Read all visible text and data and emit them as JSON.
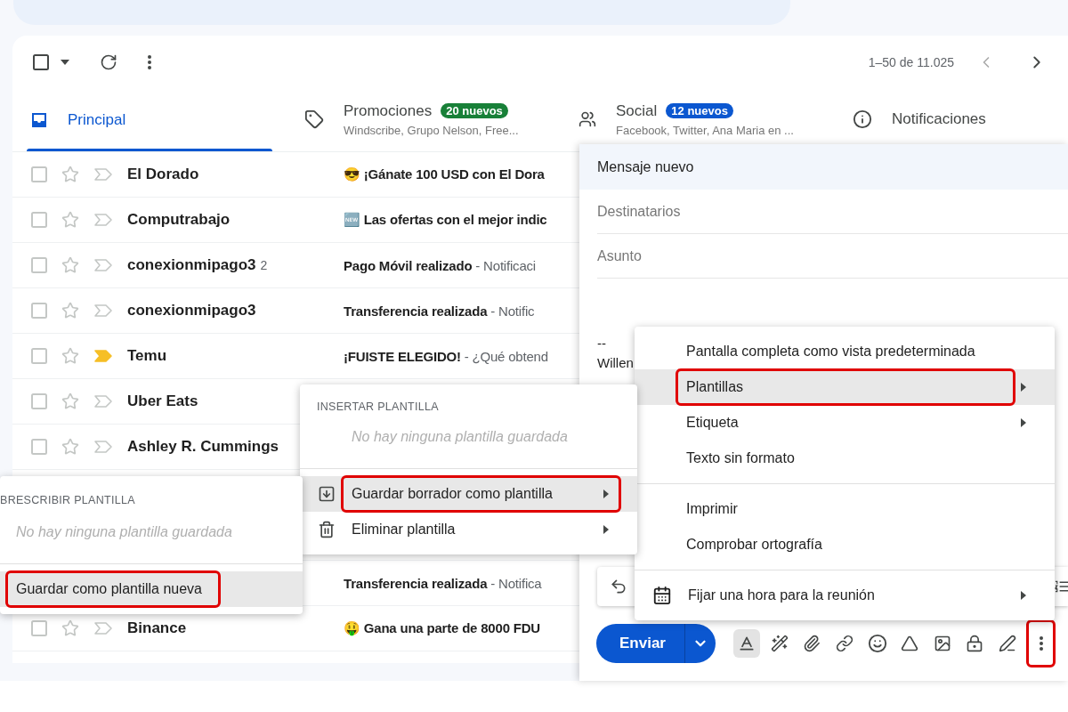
{
  "toolbar": {
    "pager": "1–50 de 11.025",
    "all_selected": false
  },
  "tabs": [
    {
      "kind": "inbox",
      "label": "Principal",
      "selected": true
    },
    {
      "kind": "tag",
      "label": "Promociones",
      "badge": "20 nuevos",
      "color": "#188038",
      "subtitle": "Windscribe, Grupo Nelson, Free...",
      "selected": false
    },
    {
      "kind": "people",
      "label": "Social",
      "badge": "12 nuevos",
      "color": "#0b57d0",
      "subtitle": "Facebook, Twitter, Ana Maria en ...",
      "selected": false
    },
    {
      "kind": "info",
      "label": "Notificaciones",
      "selected": false
    }
  ],
  "rows": [
    {
      "sender": "El Dorado",
      "subject": "😎 ¡Gánate 100 USD con El Dora",
      "important": false,
      "selected": false
    },
    {
      "sender": "Computrabajo",
      "subject": "🆕 Las ofertas con el mejor indic",
      "important": false,
      "selected": false
    },
    {
      "sender": "conexionmipago3",
      "count": "2",
      "subject": "Pago Móvil realizado",
      "snippet": "- Notificaci",
      "important": false,
      "selected": false
    },
    {
      "sender": "conexionmipago3",
      "subject": "Transferencia realizada",
      "snippet": "- Notific",
      "important": false,
      "selected": false
    },
    {
      "sender": "Temu",
      "subject": "¡FUISTE ELEGIDO!",
      "snippet": "- ¿Qué obtend",
      "important": true,
      "selected": false
    },
    {
      "sender": "Uber Eats",
      "important": false,
      "selected": false
    },
    {
      "sender": "Ashley R. Cummings",
      "important": false,
      "selected": false
    },
    {},
    {},
    {
      "subject": "Transferencia realizada",
      "snippet": "- Notifica"
    },
    {
      "sender": "Binance",
      "subject": "🤑 Gana una parte de 8000 FDU",
      "important": false,
      "selected": false
    }
  ],
  "compose": {
    "title": "Mensaje nuevo",
    "to_placeholder": "Destinatarios",
    "subject_placeholder": "Asunto",
    "signature": [
      "--",
      "Willen"
    ],
    "send": "Enviar",
    "more_highlighted": true
  },
  "options_menu": {
    "sections": [
      [
        {
          "kind": "plain",
          "label": "Pantalla completa como vista predeterminada",
          "submenu": false,
          "hovered": false,
          "highlighted": false
        },
        {
          "kind": "plain",
          "label": "Plantillas",
          "submenu": true,
          "hovered": true,
          "highlighted": true
        },
        {
          "kind": "plain",
          "label": "Etiqueta",
          "submenu": true,
          "hovered": false,
          "highlighted": false
        },
        {
          "kind": "plain",
          "label": "Texto sin formato",
          "submenu": false,
          "hovered": false,
          "highlighted": false
        }
      ],
      [
        {
          "kind": "plain",
          "label": "Imprimir",
          "submenu": false,
          "hovered": false,
          "highlighted": false
        },
        {
          "kind": "plain",
          "label": "Comprobar ortografía",
          "submenu": false,
          "hovered": false,
          "highlighted": false
        }
      ],
      [
        {
          "kind": "calendar",
          "label": "Fijar una hora para la reunión",
          "submenu": true,
          "hovered": false,
          "highlighted": false
        }
      ]
    ]
  },
  "template_menu": {
    "heading": "INSERTAR PLANTILLA",
    "empty": "No hay ninguna plantilla guardada",
    "items": [
      {
        "kind": "save",
        "label": "Guardar borrador como plantilla",
        "submenu": true,
        "hovered": true,
        "highlighted": true
      },
      {
        "kind": "delete",
        "label": "Eliminar plantilla",
        "submenu": true,
        "hovered": false,
        "highlighted": false
      }
    ]
  },
  "overwrite_menu": {
    "heading": "BRESCRIBIR PLANTILLA",
    "empty": "No hay ninguna plantilla guardada",
    "items": [
      {
        "label": "Guardar como plantilla nueva",
        "submenu": false,
        "hovered": true,
        "highlighted": true
      }
    ]
  }
}
